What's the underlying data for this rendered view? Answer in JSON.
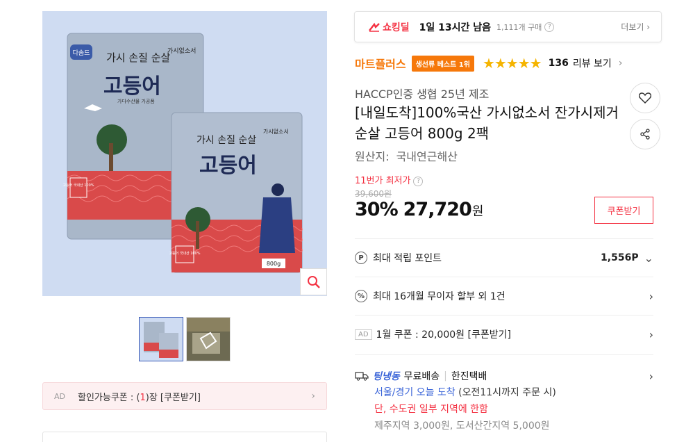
{
  "product_image": {
    "alt": "고등어 제품 이미지",
    "package_brand": "다솜드",
    "package_title_small": "가시 손질 순살",
    "package_title_big": "고등어",
    "package_tag": "가시없소서",
    "package_sub": "가다수산물 가공품",
    "package_weight": "800g",
    "package_badge": "고등어 국내산 100%",
    "bg_color": "#cfdcf2"
  },
  "ad_coupon": {
    "ad_label": "AD",
    "prefix": "할인가능쿠폰 : (",
    "count": "1",
    "suffix": ")장 [쿠폰받기]"
  },
  "deal": {
    "logo": "쇼킹딜",
    "time_left": "1일 13시간 남음",
    "purchase_count": "1,111개 구매",
    "more": "더보기"
  },
  "brand": {
    "name": "마트플러스",
    "best_badge": "생선류 베스트 1위",
    "rating": 4.5,
    "stars": "★★★★★",
    "review_count": "136",
    "review_link": "리뷰 보기"
  },
  "product": {
    "subtitle": "HACCP인증 생협 25년 제조",
    "title": "[내일도착]100%국산 가시없소서 잔가시제거 순살 고등어 800g 2팩",
    "origin_label": "원산지:",
    "origin_value": "국내연근해산"
  },
  "pricing": {
    "lowest_label": "11번가 최저가",
    "original_price": "39,600원",
    "discount": "30%",
    "price": "27,720",
    "currency": "원",
    "coupon_button": "쿠폰받기"
  },
  "rows": {
    "points_icon": "P",
    "points_label": "최대 적립 포인트",
    "points_value": "1,556P",
    "installment_icon": "%",
    "installment_label": "최대 16개월 무이자 할부 외 1건",
    "coupon_ad": "AD",
    "coupon_label": "1월 쿠폰 : 20,000원 [쿠폰받기]"
  },
  "shipping": {
    "brand": "팅냉동",
    "free": "무료배송",
    "carrier": "한진택배",
    "arrival": "서울/경기 오늘 도착",
    "arrival_note": "(오전11시까지 주문 시)",
    "warning": "단, 수도권 일부 지역에 한함",
    "extra_fee": "제주지역 3,000원, 도서산간지역 5,000원"
  },
  "colors": {
    "accent_red": "#f43142",
    "brand_orange": "#f6780a",
    "star_yellow": "#f5b400",
    "ship_blue": "#3a64d8"
  }
}
